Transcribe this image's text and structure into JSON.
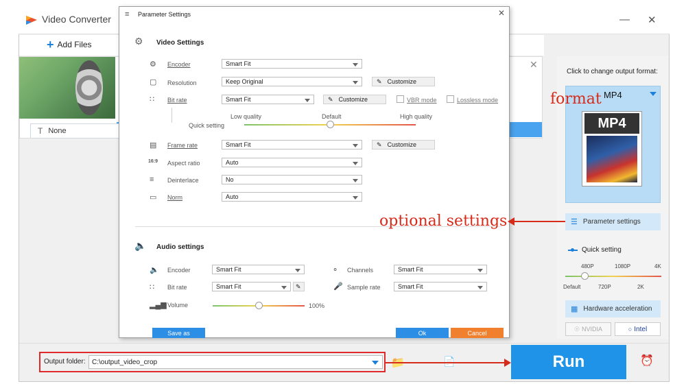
{
  "app": {
    "title": "Video Converter",
    "minimize": "—",
    "close": "✕"
  },
  "toolbar": {
    "add_files": "Add Files"
  },
  "file": {
    "subtitle_value": "None",
    "close": "✕"
  },
  "right": {
    "click_change": "Click to change output format:",
    "format_name": "MP4",
    "format_icon_label": "MP4",
    "parameter_settings": "Parameter settings",
    "quick_setting": "Quick setting",
    "ticks_top": [
      "480P",
      "1080P",
      "4K"
    ],
    "ticks_bottom": [
      "Default",
      "720P",
      "2K"
    ],
    "quick_setting_level": 0.2,
    "hardware_acceleration": "Hardware acceleration",
    "nvidia": "NVIDIA",
    "intel": "Intel"
  },
  "bottom": {
    "output_folder_label": "Output folder:",
    "output_folder_value": "C:\\output_video_crop",
    "run": "Run"
  },
  "dialog": {
    "title": "Parameter Settings",
    "close": "✕",
    "video_section": "Video Settings",
    "video": {
      "encoder_label": "Encoder",
      "encoder_value": "Smart Fit",
      "resolution_label": "Resolution",
      "resolution_value": "Keep Original",
      "resolution_customize": "Customize",
      "bitrate_label": "Bit rate",
      "bitrate_value": "Smart Fit",
      "bitrate_customize": "Customize",
      "vbr_mode": "VBR mode",
      "lossless_mode": "Lossless mode",
      "quick_setting": "Quick setting",
      "low_quality": "Low quality",
      "default": "Default",
      "high_quality": "High quality",
      "quality_level": 0.5,
      "framerate_label": "Frame rate",
      "framerate_value": "Smart Fit",
      "framerate_customize": "Customize",
      "aspect_label": "Aspect ratio",
      "aspect_value": "Auto",
      "deinterlace_label": "Deinterlace",
      "deinterlace_value": "No",
      "norm_label": "Norm",
      "norm_value": "Auto"
    },
    "audio_section": "Audio settings",
    "audio": {
      "encoder_label": "Encoder",
      "encoder_value": "Smart Fit",
      "channels_label": "Channels",
      "channels_value": "Smart Fit",
      "bitrate_label": "Bit rate",
      "bitrate_value": "Smart Fit",
      "samplerate_label": "Sample rate",
      "samplerate_value": "Smart Fit",
      "volume_label": "Volume",
      "volume_value": "100%",
      "volume_level": 0.5
    },
    "save_as": "Save as",
    "ok": "Ok",
    "cancel": "Cancel"
  },
  "annotations": {
    "format": "format",
    "optional_settings": "optional settings",
    "color": "#d62a1a"
  }
}
